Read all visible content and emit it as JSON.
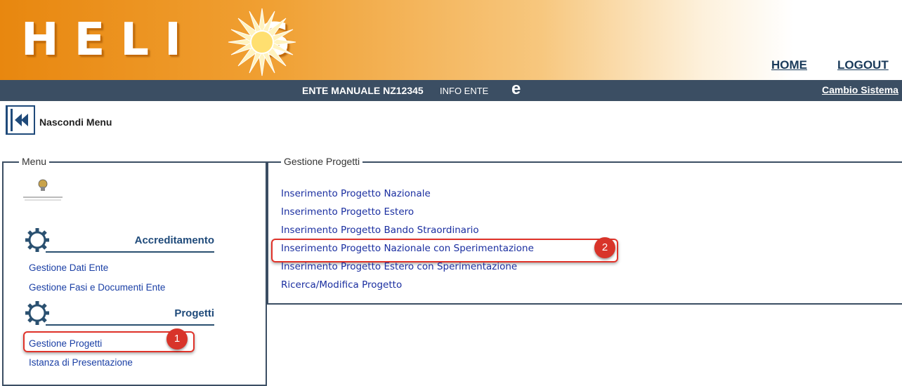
{
  "header": {
    "logo_text": "HELIOS",
    "logo_left": "HELI",
    "logo_right": "S",
    "nav": {
      "home": "HOME",
      "logout": "LOGOUT"
    }
  },
  "ente_bar": {
    "ente_label": "ENTE MANUALE  NZ12345",
    "info_ente": "INFO ENTE",
    "e_icon": "e",
    "cambio_sistema": "Cambio Sistema"
  },
  "toggle": {
    "label": "Nascondi Menu",
    "icon": "double-chevron-left-icon"
  },
  "menu": {
    "legend": "Menu",
    "sections": [
      {
        "title": "Accreditamento",
        "icon": "gear-icon",
        "items": [
          "Gestione Dati Ente",
          "Gestione Fasi e Documenti Ente"
        ]
      },
      {
        "title": "Progetti",
        "icon": "gear-icon",
        "items": [
          "Gestione Progetti",
          "Istanza di Presentazione"
        ]
      }
    ]
  },
  "gestione_progetti": {
    "legend": "Gestione Progetti",
    "links": [
      "Inserimento Progetto Nazionale",
      "Inserimento Progetto Estero",
      "Inserimento Progetto Bando Straordinario",
      "Inserimento Progetto Nazionale con Sperimentazione",
      "Inserimento Progetto Estero con Sperimentazione",
      "Ricerca/Modifica Progetto"
    ]
  },
  "annotations": {
    "badge_1": "1",
    "badge_2": "2",
    "highlight_color": "#e0332a"
  },
  "colors": {
    "dark_bar": "#3b4e63",
    "link": "#1a3fa5",
    "banner_orange": "#e8870f"
  }
}
